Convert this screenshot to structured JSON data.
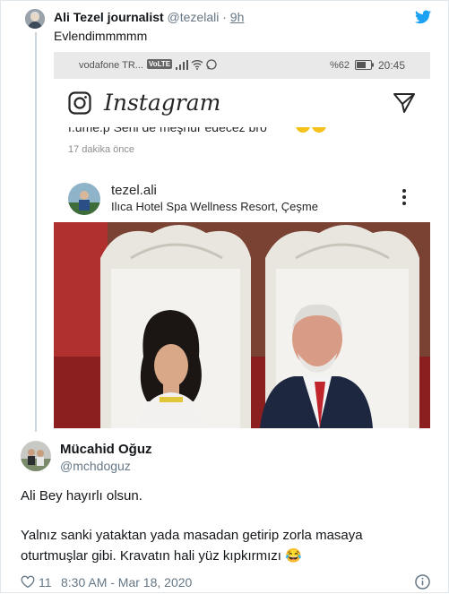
{
  "tweet1": {
    "name": "Ali Tezel journalist",
    "handle": "@tezelali",
    "separator": "·",
    "time": "9h",
    "text": "Evlendimmmmm"
  },
  "screenshot": {
    "status": {
      "carrier": "vodafone TR...",
      "volte": "VoLTE",
      "battery": "%62",
      "clock": "20:45"
    },
    "instagram": {
      "wordmark": "Instagram",
      "comment_partial": "f.ume.p Seni de meşhur edecez bro",
      "comment_time": "17 dakika önce",
      "user": "tezel.ali",
      "location": "Ilıca Hotel Spa Wellness Resort, Çeşme"
    }
  },
  "tweet2": {
    "name": "Mücahid Oğuz",
    "handle": "@mchdoguz",
    "line1": "Ali Bey hayırlı olsun.",
    "line2": "Yalnız sanki yataktan yada masadan getirip zorla masaya",
    "line3": "oturtmuşlar gibi. Kravatın hali yüz kıpkırmızı",
    "emoji": "😂",
    "likes": "11",
    "timestamp": "8:30 AM - Mar 18, 2020"
  },
  "icons": {
    "twitter": "twitter-bird-icon",
    "heart": "heart-icon",
    "info": "info-icon",
    "camera": "instagram-camera-icon",
    "send": "paper-plane-icon",
    "more": "more-vertical-icon"
  },
  "colors": {
    "twitter_blue": "#1da1f2",
    "muted": "#657786",
    "thread_line": "#ccd6dd"
  }
}
